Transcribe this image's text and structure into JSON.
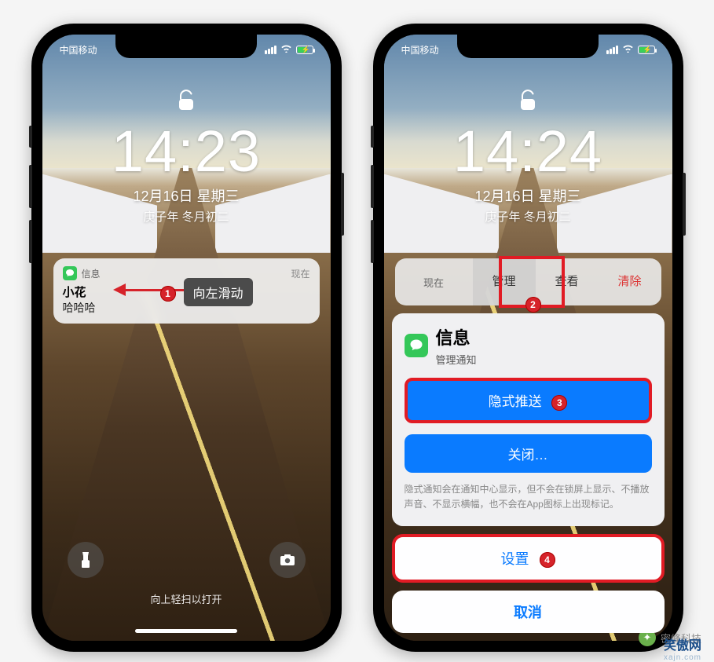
{
  "phone1": {
    "carrier": "中国移动",
    "clock": "14:23",
    "date": "12月16日 星期三",
    "subdate": "庚子年 冬月初二",
    "notification": {
      "app_name": "信息",
      "time_label": "现在",
      "sender": "小花",
      "body": "哈哈哈"
    },
    "annotation": {
      "step1_num": "1",
      "tip": "向左滑动"
    },
    "swipe_hint": "向上轻扫以打开"
  },
  "phone2": {
    "carrier": "中国移动",
    "clock": "14:24",
    "date": "12月16日 星期三",
    "subdate": "庚子年 冬月初二",
    "strip": {
      "now": "现在",
      "manage": "管理",
      "view": "查看",
      "clear": "清除",
      "step2_num": "2"
    },
    "sheet": {
      "app_title": "信息",
      "subtitle": "管理通知",
      "hide_push": "隐式推送",
      "step3_num": "3",
      "close": "关闭…",
      "note": "隐式通知会在通知中心显示，但不会在锁屏上显示、不播放声音、不显示横幅，也不会在App图标上出现标记。",
      "settings": "设置",
      "step4_num": "4",
      "cancel": "取消"
    }
  },
  "watermark": {
    "label": "密峰科技"
  },
  "watermark2": {
    "brand": "笑傲网",
    "sub": "xajn.com"
  }
}
